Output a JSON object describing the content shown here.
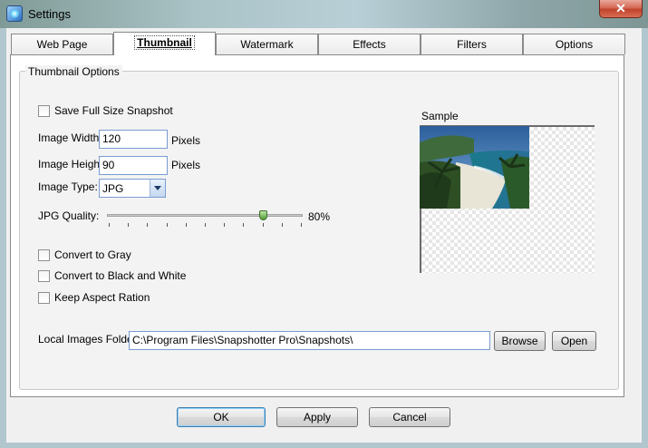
{
  "window": {
    "title": "Settings",
    "close_glyph": "✕"
  },
  "tabs": [
    {
      "label": "Web Page"
    },
    {
      "label": "Thumbnail",
      "active": true
    },
    {
      "label": "Watermark"
    },
    {
      "label": "Effects"
    },
    {
      "label": "Filters"
    },
    {
      "label": "Options"
    }
  ],
  "thumbnail_options": {
    "group_title": "Thumbnail Options",
    "save_full_size": {
      "label": "Save Full Size Snapshot",
      "checked": false
    },
    "image_width": {
      "label": "Image Width:",
      "value": "120",
      "unit": "Pixels"
    },
    "image_height": {
      "label": "Image Height:",
      "value": "90",
      "unit": "Pixels"
    },
    "image_type": {
      "label": "Image Type:",
      "value": "JPG"
    },
    "jpg_quality": {
      "label": "JPG Quality:",
      "value_text": "80%",
      "value": 80
    },
    "convert_gray": {
      "label": "Convert to Gray",
      "checked": false
    },
    "convert_bw": {
      "label": "Convert to Black and White",
      "checked": false
    },
    "keep_aspect": {
      "label": "Keep Aspect Ration",
      "checked": false
    },
    "local_folder": {
      "label": "Local Images Folder:",
      "value": "C:\\Program Files\\Snapshotter Pro\\Snapshots\\"
    },
    "browse_label": "Browse",
    "open_label": "Open",
    "sample_label": "Sample"
  },
  "footer": {
    "ok_label": "OK",
    "apply_label": "Apply",
    "cancel_label": "Cancel"
  },
  "colors": {
    "accent": "#7a9cd3",
    "close": "#c0422b"
  }
}
